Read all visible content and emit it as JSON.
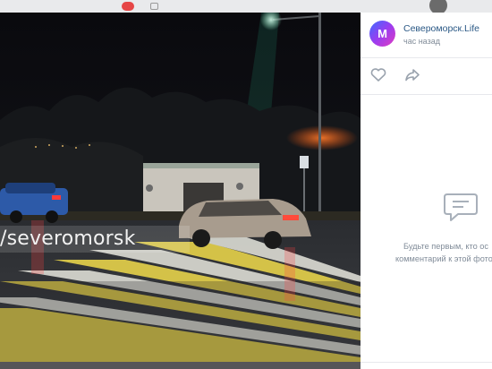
{
  "header": {
    "notification_badge": "",
    "icons": [
      "bell-icon",
      "message-icon",
      "avatar"
    ]
  },
  "photo": {
    "watermark": "/severomorsk"
  },
  "post": {
    "author": "Североморск.Life",
    "time": "час назад",
    "logo_letter": "М"
  },
  "actions": {
    "icons": [
      "heart-icon",
      "share-icon"
    ]
  },
  "comments": {
    "empty_line1": "Будьте первым, кто ос",
    "empty_line2": "комментарий к этой фото"
  },
  "colors": {
    "link": "#2a5885",
    "muted": "#818c99",
    "badge": "#e64646"
  }
}
